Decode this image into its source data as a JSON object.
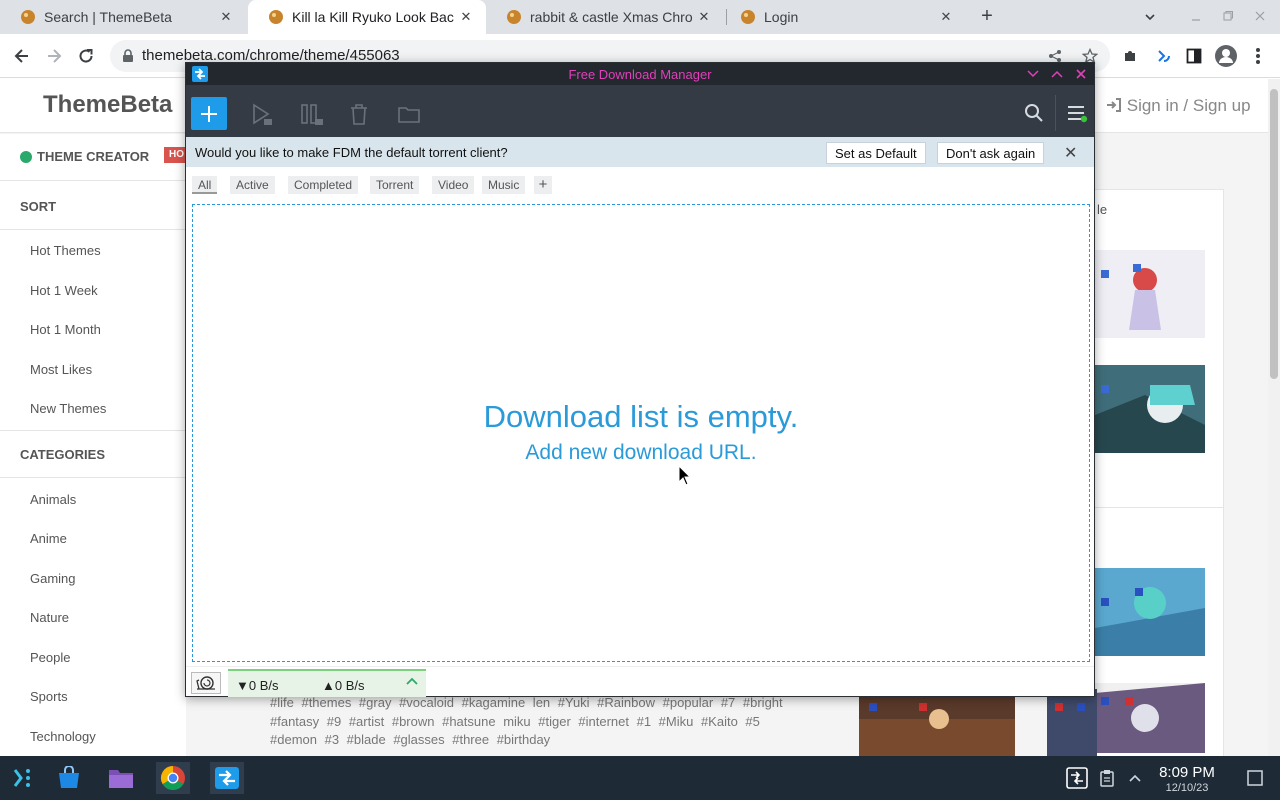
{
  "browser": {
    "tabs": [
      {
        "label": "Search | ThemeBeta",
        "close": "✕",
        "icon": "themebeta-favicon"
      },
      {
        "label": "Kill la Kill Ryuko Look Bac",
        "close": "✕",
        "icon": "themebeta-favicon"
      },
      {
        "label": "rabbit & castle Xmas Chro",
        "close": "✕",
        "icon": "themebeta-favicon"
      },
      {
        "label": "Login",
        "close": "✕",
        "icon": "themebeta-favicon"
      }
    ],
    "new_tab": "+",
    "url": "themebeta.com/chrome/theme/455063"
  },
  "site": {
    "logo": "ThemeBeta",
    "signin": "Sign in / Sign up",
    "theme_creator": "THEME CREATOR",
    "hot_badge": "HO",
    "sort_heading": "SORT",
    "sort_items": [
      "Hot Themes",
      "Hot 1 Week",
      "Hot 1 Month",
      "Most Likes",
      "New Themes"
    ],
    "categories_heading": "CATEGORIES",
    "category_items": [
      "Animals",
      "Anime",
      "Gaming",
      "Nature",
      "People",
      "Sports",
      "Technology"
    ],
    "right_heading_fragment": "le",
    "tags": "#life #themes #gray #vocaloid #kagamine len #Yuki #Rainbow #popular #7 #bright #fantasy #9 #artist #brown #hatsune miku #tiger #internet #1 #Miku #Kaito #5 #demon #3 #blade #glasses #three #birthday"
  },
  "fdm": {
    "title": "Free Download Manager",
    "banner_text": "Would you like to make FDM the default torrent client?",
    "set_default": "Set as Default",
    "dont_ask": "Don't ask again",
    "banner_close": "✕",
    "filters": [
      "All",
      "Active",
      "Completed",
      "Torrent",
      "Video",
      "Music"
    ],
    "filter_add": "+",
    "empty_title": "Download list is empty.",
    "empty_sub": "Add new download URL.",
    "down_speed": "▼0 B/s",
    "up_speed": "▲0 B/s",
    "accent": "#1e9be9",
    "title_color": "#e040b8"
  },
  "taskbar": {
    "time": "8:09 PM",
    "date": "12/10/23"
  }
}
